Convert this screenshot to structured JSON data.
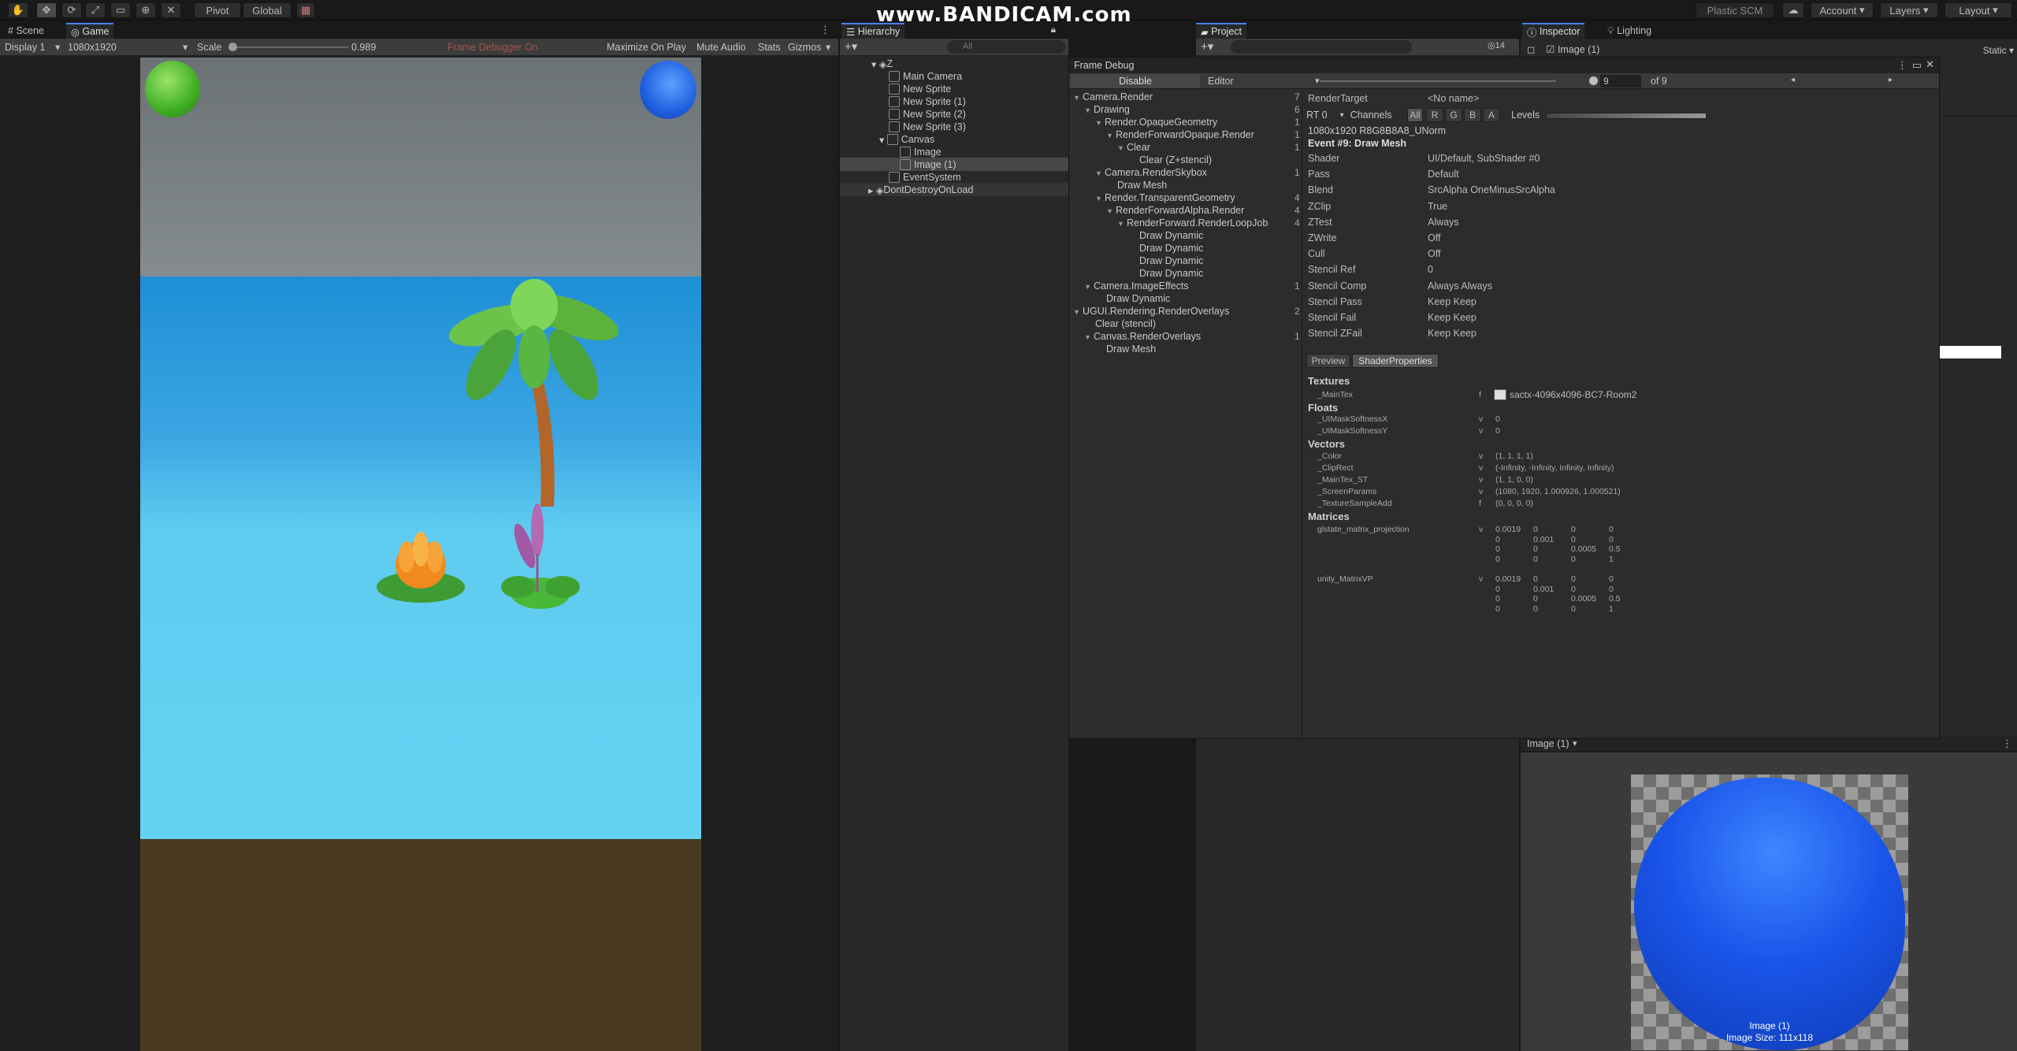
{
  "toolbar": {
    "pivot": "Pivot",
    "global": "Global",
    "plastic": "Plastic SCM",
    "account": "Account",
    "layers": "Layers",
    "layout": "Layout"
  },
  "watermark": "www.BANDICAM.com",
  "game": {
    "tabs": [
      "Scene",
      "Game"
    ],
    "display": "Display 1",
    "resolution": "1080x1920",
    "scale_label": "Scale",
    "scale_value": "0.989",
    "frame_debugger_on": "Frame Debugger On",
    "maximize": "Maximize On Play",
    "mute": "Mute Audio",
    "stats": "Stats",
    "gizmos": "Gizmos"
  },
  "hierarchy": {
    "tab": "Hierarchy",
    "search_placeholder": "All",
    "items": [
      "Z",
      "Main Camera",
      "New Sprite",
      "New Sprite (1)",
      "New Sprite (2)",
      "New Sprite (3)",
      "Canvas",
      "Image",
      "Image (1)",
      "EventSystem",
      "DontDestroyOnLoad"
    ]
  },
  "project": {
    "tab": "Project",
    "count": "14"
  },
  "inspector": {
    "tab": "Inspector",
    "lighting_tab": "Lighting",
    "object_name": "Image (1)",
    "static_label": "Static"
  },
  "frame_debug": {
    "title": "Frame Debug",
    "disable": "Disable",
    "editor": "Editor",
    "event_num": "9",
    "of": "of 9",
    "tree": [
      {
        "label": "Camera.Render",
        "count": "7"
      },
      {
        "label": "Drawing",
        "count": "6"
      },
      {
        "label": "Render.OpaqueGeometry",
        "count": "1"
      },
      {
        "label": "RenderForwardOpaque.Render",
        "count": "1"
      },
      {
        "label": "Clear",
        "count": "1"
      },
      {
        "label": "Clear (Z+stencil)",
        "count": ""
      },
      {
        "label": "Camera.RenderSkybox",
        "count": "1"
      },
      {
        "label": "Draw Mesh",
        "count": ""
      },
      {
        "label": "Render.TransparentGeometry",
        "count": "4"
      },
      {
        "label": "RenderForwardAlpha.Render",
        "count": "4"
      },
      {
        "label": "RenderForward.RenderLoopJob",
        "count": "4"
      },
      {
        "label": "Draw Dynamic",
        "count": ""
      },
      {
        "label": "Draw Dynamic",
        "count": ""
      },
      {
        "label": "Draw Dynamic",
        "count": ""
      },
      {
        "label": "Draw Dynamic",
        "count": ""
      },
      {
        "label": "Camera.ImageEffects",
        "count": "1"
      },
      {
        "label": "Draw Dynamic",
        "count": ""
      },
      {
        "label": "UGUI.Rendering.RenderOverlays",
        "count": "2"
      },
      {
        "label": "Clear (stencil)",
        "count": ""
      },
      {
        "label": "Canvas.RenderOverlays",
        "count": "1"
      },
      {
        "label": "Draw Mesh",
        "count": ""
      }
    ],
    "render_target_label": "RenderTarget",
    "render_target_value": "<No name>",
    "rt": "RT 0",
    "channels": "Channels",
    "ch_all": "All",
    "ch_r": "R",
    "ch_g": "G",
    "ch_b": "B",
    "ch_a": "A",
    "levels": "Levels",
    "format": "1080x1920 R8G8B8A8_UNorm",
    "event_title": "Event #9: Draw Mesh",
    "props": [
      {
        "k": "Shader",
        "v": "UI/Default, SubShader #0"
      },
      {
        "k": "Pass",
        "v": "Default"
      },
      {
        "k": "Blend",
        "v": "SrcAlpha OneMinusSrcAlpha"
      },
      {
        "k": "ZClip",
        "v": "True"
      },
      {
        "k": "ZTest",
        "v": "Always"
      },
      {
        "k": "ZWrite",
        "v": "Off"
      },
      {
        "k": "Cull",
        "v": "Off"
      },
      {
        "k": "Stencil Ref",
        "v": "0"
      },
      {
        "k": "Stencil Comp",
        "v": "Always Always"
      },
      {
        "k": "Stencil Pass",
        "v": "Keep Keep"
      },
      {
        "k": "Stencil Fail",
        "v": "Keep Keep"
      },
      {
        "k": "Stencil ZFail",
        "v": "Keep Keep"
      }
    ],
    "preview_tab": "Preview",
    "shaderprops_tab": "ShaderProperties",
    "textures_h": "Textures",
    "maintex": "_MainTex",
    "maintex_t": "f",
    "maintex_v": "sactx-4096x4096-BC7-Room2",
    "floats_h": "Floats",
    "floats": [
      {
        "k": "_UIMaskSoftnessX",
        "t": "v",
        "v": "0"
      },
      {
        "k": "_UIMaskSoftnessY",
        "t": "v",
        "v": "0"
      }
    ],
    "vectors_h": "Vectors",
    "vectors": [
      {
        "k": "_Color",
        "t": "v",
        "v": "(1, 1, 1, 1)"
      },
      {
        "k": "_ClipRect",
        "t": "v",
        "v": "(-Infinity, -Infinity, Infinity, Infinity)"
      },
      {
        "k": "_MainTex_ST",
        "t": "v",
        "v": "(1, 1, 0, 0)"
      },
      {
        "k": "_ScreenParams",
        "t": "v",
        "v": "(1080, 1920, 1.000926, 1.000521)"
      },
      {
        "k": "_TextureSampleAdd",
        "t": "f",
        "v": "(0, 0, 0, 0)"
      }
    ],
    "matrices_h": "Matrices",
    "m1_name": "glstate_matrix_projection",
    "m1_t": "v",
    "m1": [
      [
        "0.0019",
        "0",
        "0",
        "0"
      ],
      [
        "0",
        "0.001",
        "0",
        "0"
      ],
      [
        "0",
        "0",
        "0.0005",
        "0.5"
      ],
      [
        "0",
        "0",
        "0",
        "1"
      ]
    ],
    "m2_name": "unity_MatrixVP",
    "m2_t": "v",
    "m2": [
      [
        "0.0019",
        "0",
        "0",
        "0"
      ],
      [
        "0",
        "0.001",
        "0",
        "0"
      ],
      [
        "0",
        "0",
        "0.0005",
        "0.5"
      ],
      [
        "0",
        "0",
        "0",
        "1"
      ]
    ]
  },
  "preview": {
    "header": "Image (1)",
    "name": "Image (1)",
    "size": "Image Size: 111x118"
  }
}
